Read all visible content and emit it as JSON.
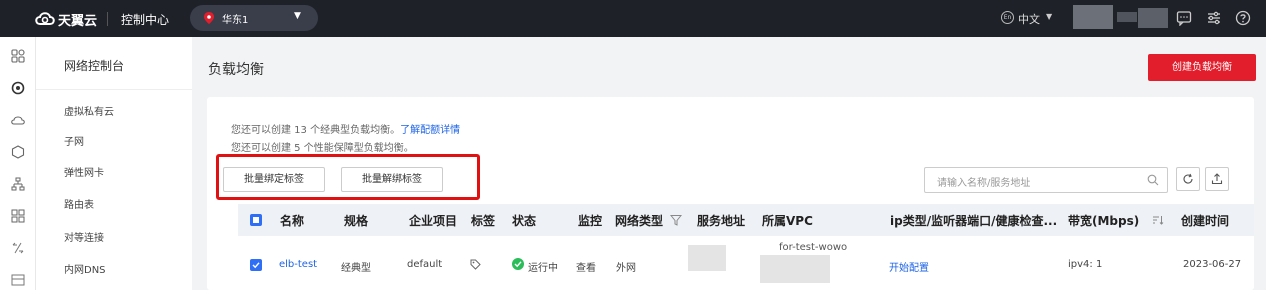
{
  "topbar": {
    "brand": "天翼云",
    "console": "控制中心",
    "region": "华东1",
    "language": "中文",
    "language_icon_text": "En",
    "icons": [
      "message-icon",
      "settings-icon",
      "help-icon"
    ]
  },
  "rail": {
    "icons": [
      "grid-icon",
      "network-icon",
      "cloud-icon",
      "hexagon-icon",
      "tree-icon",
      "blocks-icon",
      "link-icon",
      "dns-icon"
    ]
  },
  "sidebar": {
    "title": "网络控制台",
    "items": [
      {
        "label": "虚拟私有云"
      },
      {
        "label": "子网"
      },
      {
        "label": "弹性网卡"
      },
      {
        "label": "路由表"
      },
      {
        "label": "对等连接"
      },
      {
        "label": "内网DNS"
      }
    ]
  },
  "main": {
    "title": "负载均衡",
    "create_button": "创建负载均衡",
    "quota_line1": "您还可以创建 13 个经典型负载均衡。",
    "quota_link": "了解配额详情",
    "quota_line2": "您还可以创建 5 个性能保障型负载均衡。",
    "bind_tag_button": "批量绑定标签",
    "unbind_tag_button": "批量解绑标签",
    "search_placeholder": "请输入名称/服务地址"
  },
  "table": {
    "headers": {
      "name": "名称",
      "spec": "规格",
      "project": "企业项目",
      "tag": "标签",
      "status": "状态",
      "monitor": "监控",
      "network_type": "网络类型",
      "service_addr": "服务地址",
      "vpc": "所属VPC",
      "ip_type": "ip类型/监听器端口/健康检查...",
      "bandwidth": "带宽(Mbps)",
      "created": "创建时间"
    },
    "rows": [
      {
        "name": "elb-test",
        "spec": "经典型",
        "project": "default",
        "status": "运行中",
        "monitor": "查看",
        "network_type": "外网",
        "vpc": "for-test-wowo",
        "ip_type": "开始配置",
        "bandwidth": "ipv4: 1",
        "created": "2023-06-27"
      }
    ]
  },
  "colors": {
    "accent": "#e21e2c",
    "link": "#1e64e6",
    "checkbox": "#2f6ff6",
    "status_running": "#2bbd5a",
    "topbar": "#1e2128"
  }
}
